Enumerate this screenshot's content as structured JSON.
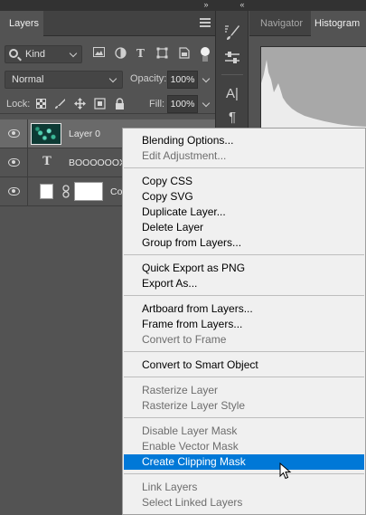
{
  "panel_collapse_glyph": "»",
  "panel_expand_glyph": "«",
  "layers_panel": {
    "tab_label": "Layers",
    "menu_icon": "hamburger-menu-icon",
    "filter_kind": "Kind",
    "blend_mode": "Normal",
    "opacity_label": "Opacity:",
    "opacity_value": "100%",
    "lock_label": "Lock:",
    "fill_label": "Fill:",
    "fill_value": "100%",
    "layers": [
      {
        "name": "Layer 0",
        "kind": "image",
        "visible": true,
        "selected": true
      },
      {
        "name": "BOOOOOOX",
        "kind": "text",
        "glyph": "T",
        "visible": true,
        "selected": false
      },
      {
        "name": "Co",
        "kind": "shape-with-mask",
        "visible": true,
        "selected": false
      }
    ]
  },
  "right_panel": {
    "tabs": [
      "Navigator",
      "Histogram"
    ],
    "active_tab": "Histogram",
    "tool_glyphs": {
      "paragraph_a": "A|",
      "paragraph": "¶"
    }
  },
  "context_menu": {
    "groups": [
      [
        {
          "label": "Blending Options...",
          "enabled": true
        },
        {
          "label": "Edit Adjustment...",
          "enabled": false
        }
      ],
      [
        {
          "label": "Copy CSS",
          "enabled": true
        },
        {
          "label": "Copy SVG",
          "enabled": true
        },
        {
          "label": "Duplicate Layer...",
          "enabled": true
        },
        {
          "label": "Delete Layer",
          "enabled": true
        },
        {
          "label": "Group from Layers...",
          "enabled": true
        }
      ],
      [
        {
          "label": "Quick Export as PNG",
          "enabled": true
        },
        {
          "label": "Export As...",
          "enabled": true
        }
      ],
      [
        {
          "label": "Artboard from Layers...",
          "enabled": true
        },
        {
          "label": "Frame from Layers...",
          "enabled": true
        },
        {
          "label": "Convert to Frame",
          "enabled": false
        }
      ],
      [
        {
          "label": "Convert to Smart Object",
          "enabled": true
        }
      ],
      [
        {
          "label": "Rasterize Layer",
          "enabled": false
        },
        {
          "label": "Rasterize Layer Style",
          "enabled": false
        }
      ],
      [
        {
          "label": "Disable Layer Mask",
          "enabled": false
        },
        {
          "label": "Enable Vector Mask",
          "enabled": false
        },
        {
          "label": "Create Clipping Mask",
          "enabled": true,
          "highlighted": true
        }
      ],
      [
        {
          "label": "Link Layers",
          "enabled": false
        },
        {
          "label": "Select Linked Layers",
          "enabled": false
        }
      ]
    ]
  },
  "colors": {
    "panel_bg": "#535353",
    "menu_bg": "#f0f0f0",
    "highlight": "#0078d7",
    "disabled_text": "#6d6d6d"
  }
}
